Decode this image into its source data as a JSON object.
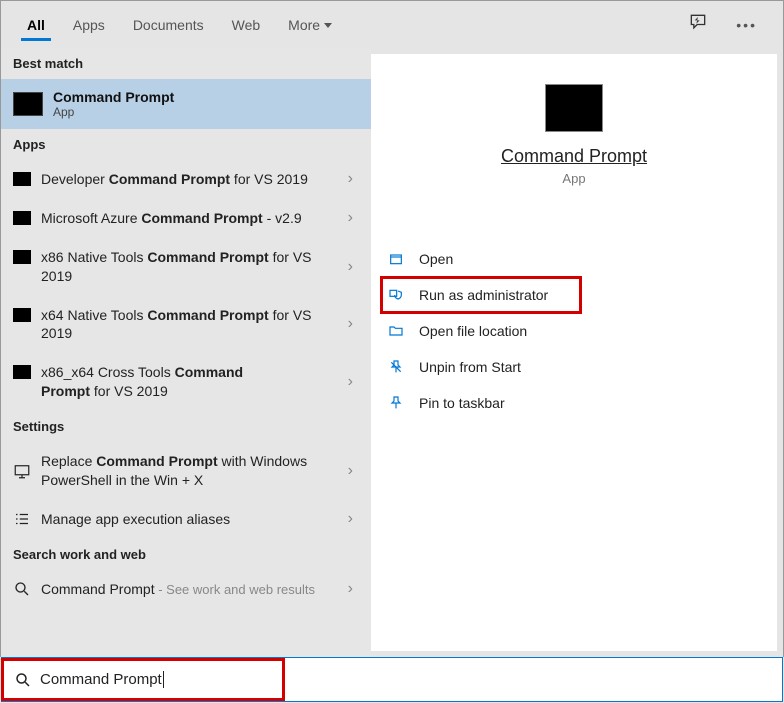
{
  "tabs": {
    "all": "All",
    "apps": "Apps",
    "documents": "Documents",
    "web": "Web",
    "more": "More"
  },
  "sections": {
    "best_match": "Best match",
    "apps": "Apps",
    "settings": "Settings",
    "search_ww": "Search work and web"
  },
  "best_match": {
    "title": "Command Prompt",
    "subtitle": "App"
  },
  "apps_list": [
    {
      "pre": "Developer ",
      "bold": "Command Prompt",
      "post": " for VS 2019"
    },
    {
      "pre": "Microsoft Azure ",
      "bold": "Command Prompt",
      "post": " - v2.9"
    },
    {
      "pre": "x86 Native Tools ",
      "bold": "Command Prompt",
      "post": " for VS 2019"
    },
    {
      "pre": "x64 Native Tools ",
      "bold": "Command Prompt",
      "post": " for VS 2019"
    },
    {
      "pre": "x86_x64 Cross Tools ",
      "bold": "Command",
      "post": "",
      "line2pre": "",
      "line2bold": "Prompt",
      "line2post": " for VS 2019"
    }
  ],
  "settings_list": [
    {
      "pre": "Replace ",
      "bold": "Command Prompt",
      "post": " with Windows PowerShell in the Win + X"
    },
    {
      "text": "Manage app execution aliases"
    }
  ],
  "web_list": {
    "term": "Command Prompt",
    "hint": " - See work and web results"
  },
  "preview": {
    "title": "Command Prompt",
    "subtitle": "App",
    "actions": {
      "open": "Open",
      "run_admin": "Run as administrator",
      "open_loc": "Open file location",
      "unpin_start": "Unpin from Start",
      "pin_taskbar": "Pin to taskbar"
    }
  },
  "search": {
    "value": "Command Prompt"
  }
}
